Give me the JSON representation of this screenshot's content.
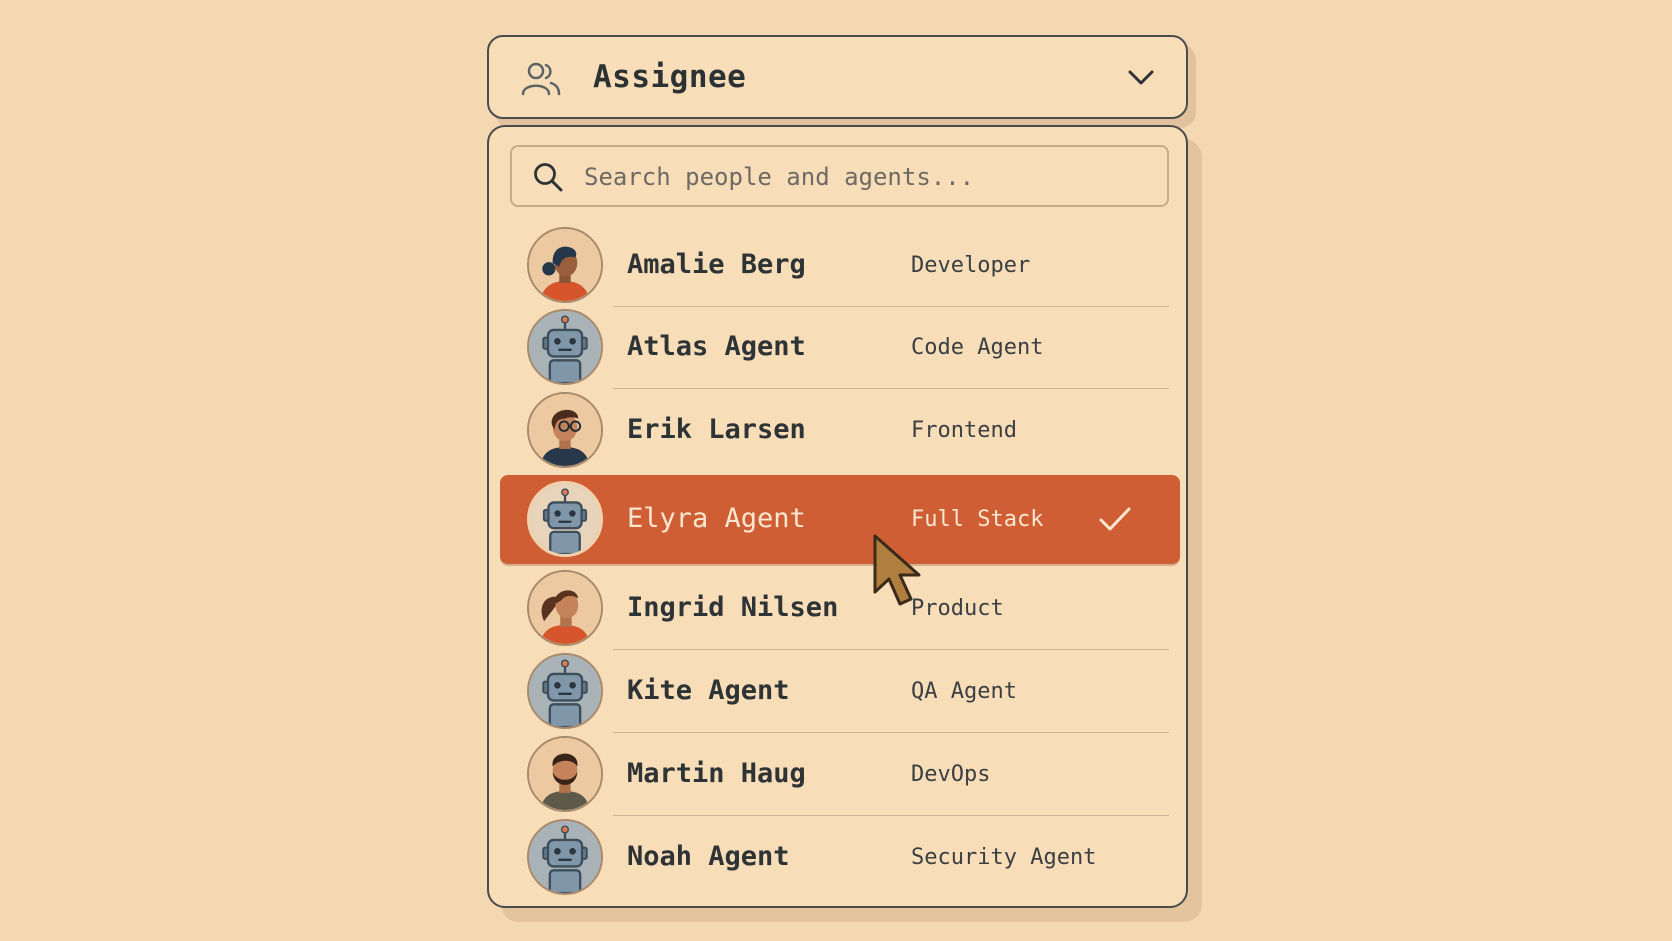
{
  "assignee": {
    "label": "Assignee",
    "icon": "people-icon"
  },
  "search": {
    "placeholder": "Search people and agents...",
    "value": ""
  },
  "people": [
    {
      "name": "Amalie Berg",
      "role": "Developer",
      "type": "person",
      "avatar": "woman-bun"
    },
    {
      "name": "Atlas Agent",
      "role": "Code Agent",
      "type": "agent",
      "avatar": "robot"
    },
    {
      "name": "Erik Larsen",
      "role": "Frontend",
      "type": "person",
      "avatar": "man-glasses"
    },
    {
      "name": "Elyra Agent",
      "role": "Full Stack",
      "type": "agent",
      "avatar": "robot",
      "selected": true
    },
    {
      "name": "Ingrid Nilsen",
      "role": "Product",
      "type": "person",
      "avatar": "woman-ponytail"
    },
    {
      "name": "Kite Agent",
      "role": "QA Agent",
      "type": "agent",
      "avatar": "robot"
    },
    {
      "name": "Martin Haug",
      "role": "DevOps",
      "type": "person",
      "avatar": "man-beard"
    },
    {
      "name": "Noah Agent",
      "role": "Security Agent",
      "type": "agent",
      "avatar": "robot"
    }
  ],
  "colors": {
    "background": "#f4d8b1",
    "panel": "#f7ddb8",
    "border": "#4a4c4c",
    "selected": "#cf5e34",
    "selected_text": "#fbe8d1",
    "text": "#2e3336"
  }
}
